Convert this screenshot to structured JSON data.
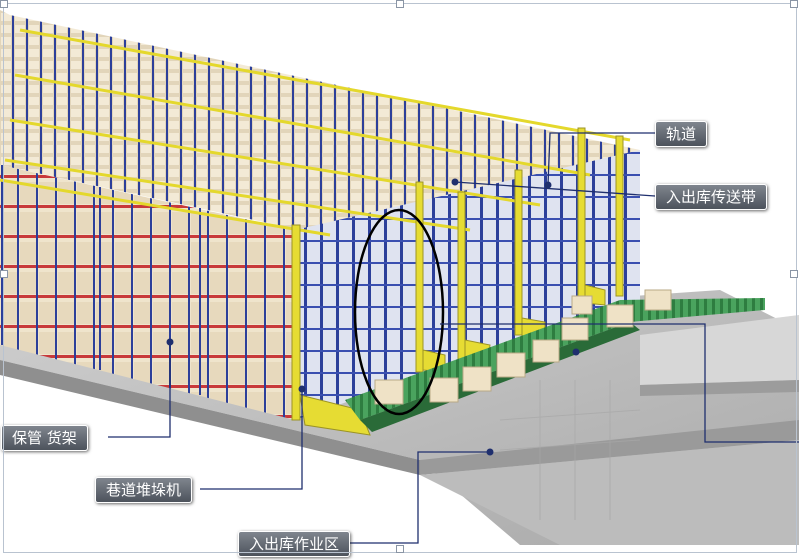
{
  "labels": {
    "rail": "轨道",
    "conveyor": "入出库传送带",
    "storage_rack": "保管 货架",
    "stacker_crane": "巷道堆垛机",
    "work_area": "入出库作业区"
  },
  "colors": {
    "rack_blue": "#2c3f9a",
    "rail_yellow": "#e4d82c",
    "carton": "#ece0c8",
    "rack_red": "#c8393a",
    "conveyor_green": "#2e8f4a",
    "floor_gray": "#c9c9c9",
    "callout_bg": "#5f656e"
  }
}
